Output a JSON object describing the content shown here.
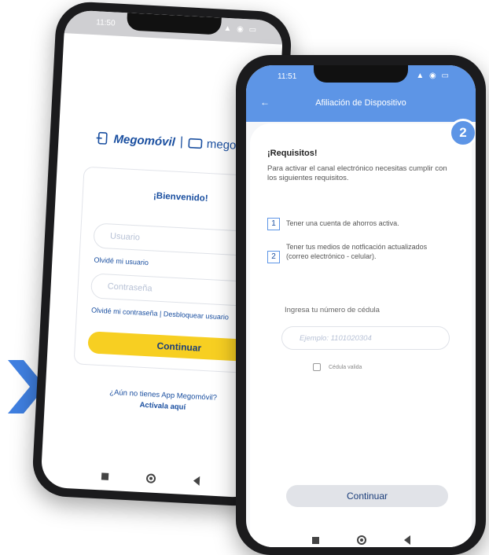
{
  "login_screen": {
    "status_time": "11:50",
    "logo_primary": "Megomóvil",
    "logo_separator": "|",
    "logo_secondary": "megowallet",
    "welcome_title": "¡Bienvenido!",
    "username_placeholder": "Usuario",
    "forgot_user_link": "Olvidé mi usuario",
    "password_placeholder": "Contraseña",
    "forgot_password_link": "Olvidé mi contraseña",
    "link_separator": "|",
    "unlock_user_link": "Desbloquear usuario",
    "continue_label": "Continuar",
    "promo_question": "¿Aún no tienes App Megomóvil?",
    "promo_action": "Actívala aquí"
  },
  "affiliation_screen": {
    "status_time": "11:51",
    "title": "Afiliación de Dispositivo",
    "step_number": "2",
    "requirements_title": "¡Requisitos!",
    "requirements_intro": "Para activar el canal electrónico necesitas cumplir con los siguientes requisitos.",
    "requirements": [
      {
        "number": "1",
        "text": "Tener una cuenta de ahorros activa."
      },
      {
        "number": "2",
        "text": "Tener tus medios de notficación actualizados (correo electrónico - celular)."
      }
    ],
    "cedula_label": "Ingresa tu número de cédula",
    "cedula_placeholder": "Ejemplo: 1101020304",
    "checkbox_label": "Cédula valida",
    "continue_label": "Continuar"
  },
  "colors": {
    "primary_blue": "#5d95e6",
    "brand_navy": "#1a4fa0",
    "accent_yellow": "#f7cf22",
    "chevron_blue": "#3f7fe0"
  }
}
